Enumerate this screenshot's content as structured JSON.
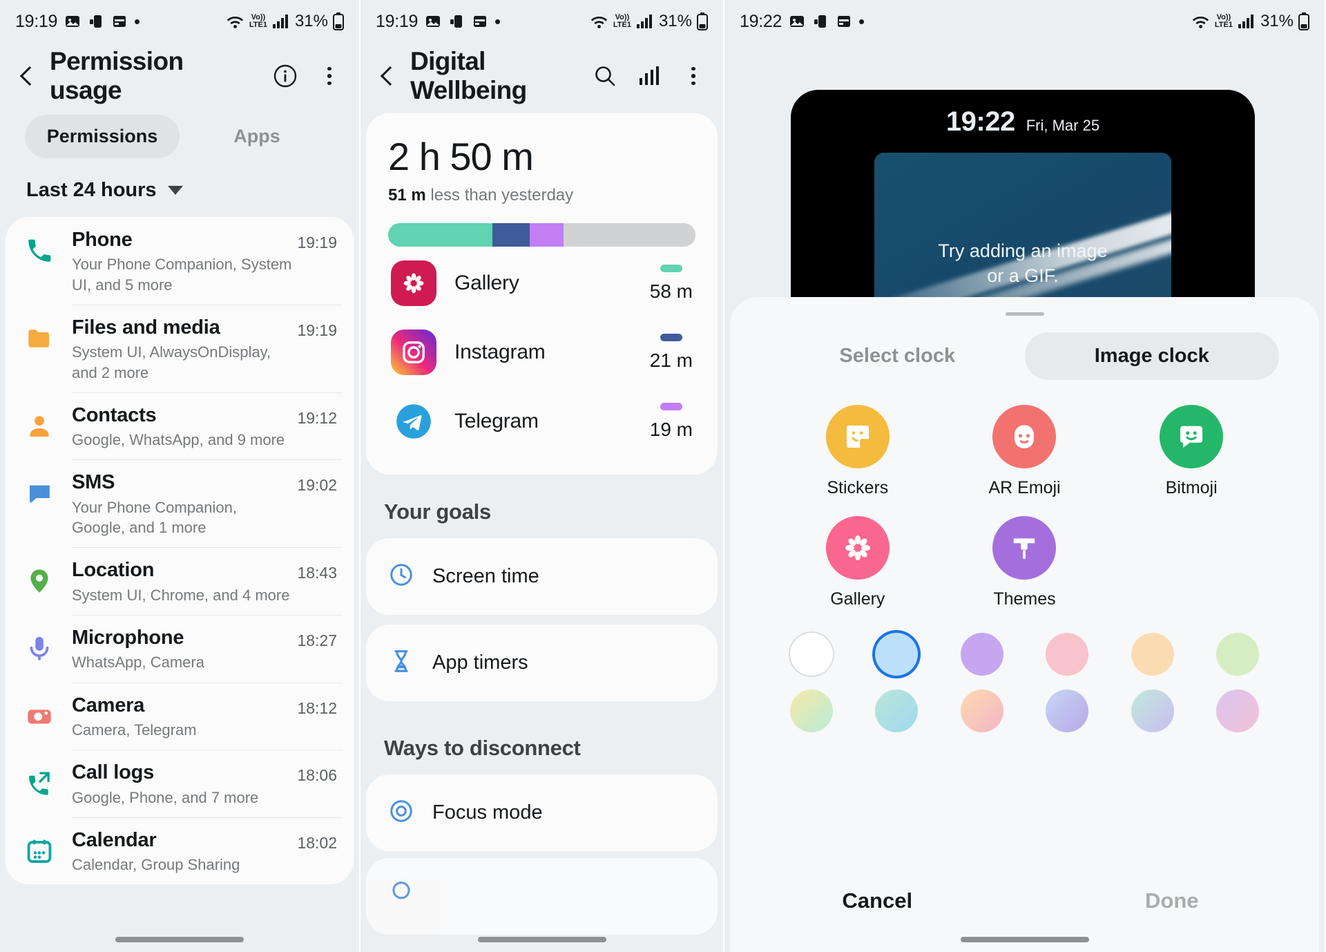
{
  "panel1": {
    "status": {
      "time": "19:19",
      "battery": "31%",
      "network": "LTE1",
      "volte": "Vo)) LTE1"
    },
    "header": {
      "title": "Permission usage",
      "back_icon": "chevron-left-icon",
      "info_icon": "info-circle-icon",
      "more_icon": "kebab-menu-icon"
    },
    "tabs": [
      {
        "label": "Permissions",
        "active": true
      },
      {
        "label": "Apps",
        "active": false
      }
    ],
    "period": {
      "label": "Last 24 hours",
      "caret": "caret-down-icon"
    },
    "rows": [
      {
        "title": "Phone",
        "subtitle": "Your Phone Companion, System UI, and 5 more",
        "time": "19:19",
        "icon": "phone-icon",
        "color": "#00a58e"
      },
      {
        "title": "Files and media",
        "subtitle": "System UI, AlwaysOnDisplay, and 2 more",
        "time": "19:19",
        "icon": "folder-icon",
        "color": "#f7ab3e"
      },
      {
        "title": "Contacts",
        "subtitle": "Google, WhatsApp, and 9 more",
        "time": "19:12",
        "icon": "person-icon",
        "color": "#f7a13b"
      },
      {
        "title": "SMS",
        "subtitle": "Your Phone Companion, Google, and 1 more",
        "time": "19:02",
        "icon": "message-bubble-icon",
        "color": "#4a90d9"
      },
      {
        "title": "Location",
        "subtitle": "System UI, Chrome, and 4 more",
        "time": "18:43",
        "icon": "location-pin-icon",
        "color": "#54b04a"
      },
      {
        "title": "Microphone",
        "subtitle": "WhatsApp, Camera",
        "time": "18:27",
        "icon": "microphone-icon",
        "color": "#7b83ef"
      },
      {
        "title": "Camera",
        "subtitle": "Camera, Telegram",
        "time": "18:12",
        "icon": "camera-icon",
        "color": "#ef7a70"
      },
      {
        "title": "Call logs",
        "subtitle": "Google, Phone, and 7 more",
        "time": "18:06",
        "icon": "call-log-icon",
        "color": "#00a58e"
      },
      {
        "title": "Calendar",
        "subtitle": "Calendar, Group Sharing",
        "time": "18:02",
        "icon": "calendar-icon",
        "color": "#15a6a1"
      }
    ]
  },
  "panel2": {
    "status": {
      "time": "19:19",
      "battery": "31%",
      "network": "LTE1"
    },
    "header": {
      "title": "Digital Wellbeing",
      "back_icon": "chevron-left-icon",
      "search_icon": "search-icon",
      "chart_icon": "bar-chart-icon",
      "more_icon": "kebab-menu-icon"
    },
    "summary": {
      "total": "2 h 50 m",
      "delta_value": "51 m",
      "delta_text": " less than yesterday"
    },
    "apps": [
      {
        "name": "Gallery",
        "duration": "58 m",
        "color": "#5fd3b2",
        "icon": "gallery-flower-icon",
        "pct": 34
      },
      {
        "name": "Instagram",
        "duration": "21 m",
        "color": "#3f5b99",
        "icon": "instagram-icon",
        "pct": 12
      },
      {
        "name": "Telegram",
        "duration": "19 m",
        "color": "#c17ef5",
        "icon": "telegram-icon",
        "pct": 11
      }
    ],
    "remaining_color": "#d0d2d4",
    "remaining_pct": 43,
    "sections": [
      {
        "title": "Your goals",
        "items": [
          {
            "label": "Screen time",
            "icon": "clock-icon",
            "color": "#4a90e2"
          },
          {
            "label": "App timers",
            "icon": "hourglass-icon",
            "color": "#4a90e2"
          }
        ]
      },
      {
        "title": "Ways to disconnect",
        "items": [
          {
            "label": "Focus mode",
            "icon": "focus-target-icon",
            "color": "#4a90e2"
          }
        ]
      }
    ]
  },
  "panel3": {
    "status": {
      "time": "19:22",
      "battery": "31%",
      "network": "LTE1"
    },
    "preview": {
      "clock_time": "19:22",
      "clock_date": "Fri, Mar 25",
      "hint_line1": "Try adding an image",
      "hint_line2": "or a GIF."
    },
    "sheet": {
      "tabs": [
        {
          "label": "Select clock",
          "active": false
        },
        {
          "label": "Image clock",
          "active": true
        }
      ],
      "options": [
        {
          "label": "Stickers",
          "color": "#f5bb3f",
          "icon": "sticker-face-icon"
        },
        {
          "label": "AR Emoji",
          "color": "#f2726f",
          "icon": "ar-emoji-icon"
        },
        {
          "label": "Bitmoji",
          "color": "#24b76a",
          "icon": "bitmoji-icon"
        },
        {
          "label": "Gallery",
          "color": "#f9678f",
          "icon": "gallery-flower-icon"
        },
        {
          "label": "Themes",
          "color": "#a46fdd",
          "icon": "themes-brush-icon"
        }
      ],
      "swatches": [
        {
          "color": "#ffffff",
          "selected": false,
          "outlined": true
        },
        {
          "color": "#bcdffb",
          "selected": true,
          "outlined": false
        },
        {
          "color": "#c6a6ef",
          "selected": false,
          "outlined": false
        },
        {
          "color": "#f9c3cb",
          "selected": false,
          "outlined": false
        },
        {
          "color": "#fbdcb2",
          "selected": false,
          "outlined": false
        },
        {
          "color": "#d6edc2",
          "selected": false,
          "outlined": false
        },
        {
          "color": "linear-gradient(135deg,#f7e8a6,#b8ecd8)",
          "selected": false,
          "outlined": false
        },
        {
          "color": "linear-gradient(135deg,#b9e6d8,#9fd9ef)",
          "selected": false,
          "outlined": false
        },
        {
          "color": "linear-gradient(135deg,#fbd9b0,#f6b6c6)",
          "selected": false,
          "outlined": false
        },
        {
          "color": "linear-gradient(135deg,#c8d6f5,#b7a8e8)",
          "selected": false,
          "outlined": false
        },
        {
          "color": "linear-gradient(135deg,#c0e9dd,#cbbdf0)",
          "selected": false,
          "outlined": false
        },
        {
          "color": "linear-gradient(135deg,#d9c4ef,#f3c2d6)",
          "selected": false,
          "outlined": false
        }
      ],
      "cancel_label": "Cancel",
      "done_label": "Done"
    }
  }
}
